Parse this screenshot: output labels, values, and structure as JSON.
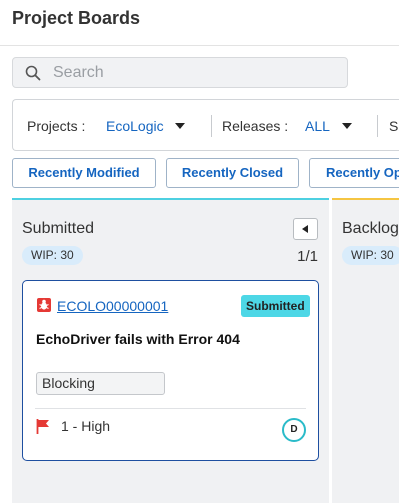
{
  "header": {
    "title": "Project Boards"
  },
  "search": {
    "placeholder": "Search"
  },
  "filters": {
    "projects_label": "Projects :",
    "projects_value": "EcoLogic",
    "releases_label": "Releases :",
    "releases_value": "ALL",
    "next_label_partial": "Sp"
  },
  "quick_filters": [
    "Recently Modified",
    "Recently Closed",
    "Recently Op"
  ],
  "columns": [
    {
      "title": "Submitted",
      "wip": "WIP: 30",
      "page_count": "1/1",
      "accent": "#4dd0e1",
      "cards": [
        {
          "id": "ECOLO00000001",
          "status": "Submitted",
          "title": "EchoDriver fails with Error 404",
          "tag": "Blocking",
          "priority": "1 - High",
          "assignee_initial": "D"
        }
      ]
    },
    {
      "title": "Backlog",
      "wip": "WIP: 30",
      "accent": "#f5c542"
    }
  ],
  "colors": {
    "link": "#1565c0",
    "status_submitted": "#4dd7e6",
    "priority_high": "#e53935"
  },
  "icons": {
    "search": "search-icon",
    "dropdown": "chevron-down-icon",
    "collapse": "chevron-left-icon",
    "item_type": "bug-icon",
    "priority": "flag-icon"
  }
}
